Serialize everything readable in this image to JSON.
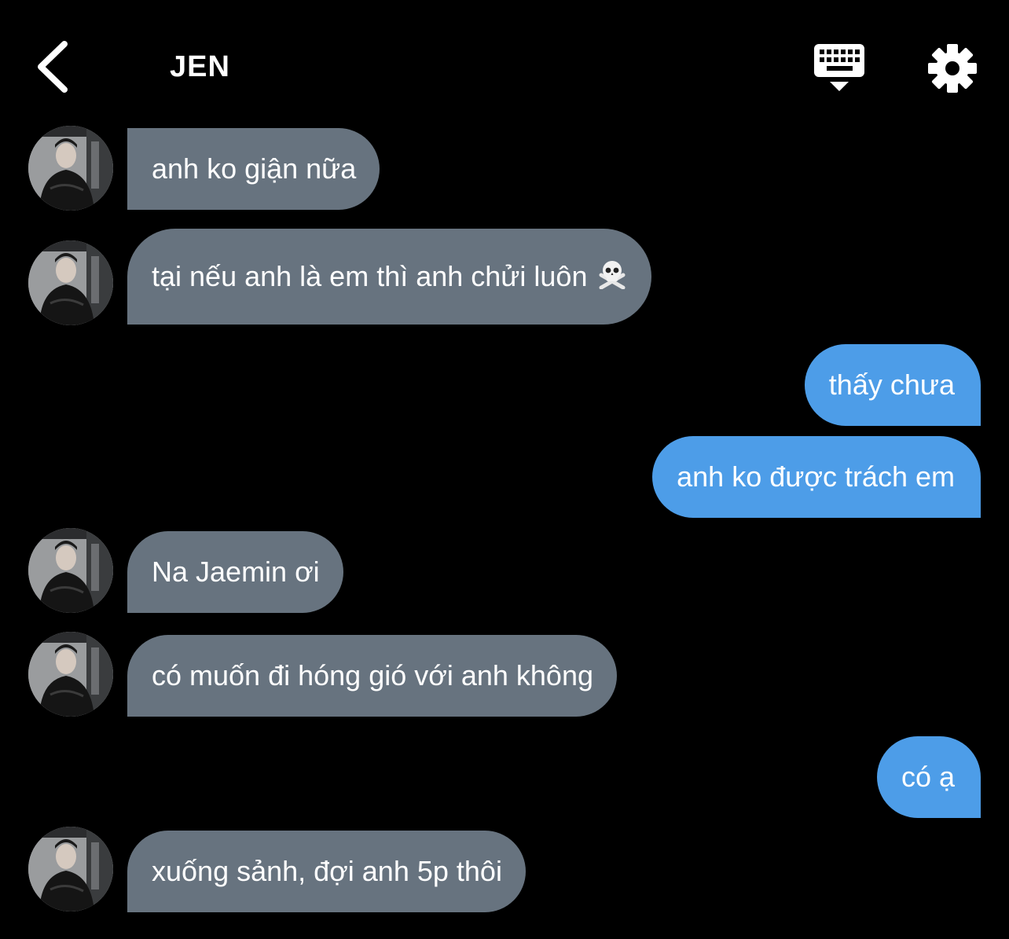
{
  "header": {
    "title": "JEN",
    "back_icon": "chevron-left-icon",
    "keyboard_icon": "keyboard-icon",
    "settings_icon": "gear-icon"
  },
  "colors": {
    "background": "#000000",
    "incoming_bubble": "#67737f",
    "outgoing_bubble": "#4d9de8",
    "text": "#ffffff"
  },
  "messages": [
    {
      "sender": "them",
      "text": "anh ko giận nữa"
    },
    {
      "sender": "them",
      "text": "tại nếu anh là em thì anh chửi luôn",
      "emoji": "skull-and-crossbones-icon"
    },
    {
      "sender": "me",
      "text": "thấy chưa"
    },
    {
      "sender": "me",
      "text": "anh ko được trách em"
    },
    {
      "sender": "them",
      "text": "Na Jaemin ơi"
    },
    {
      "sender": "them",
      "text": "có muốn đi hóng gió với anh không"
    },
    {
      "sender": "me",
      "text": "có ạ"
    },
    {
      "sender": "them",
      "text": "xuống sảnh, đợi anh 5p thôi"
    }
  ]
}
